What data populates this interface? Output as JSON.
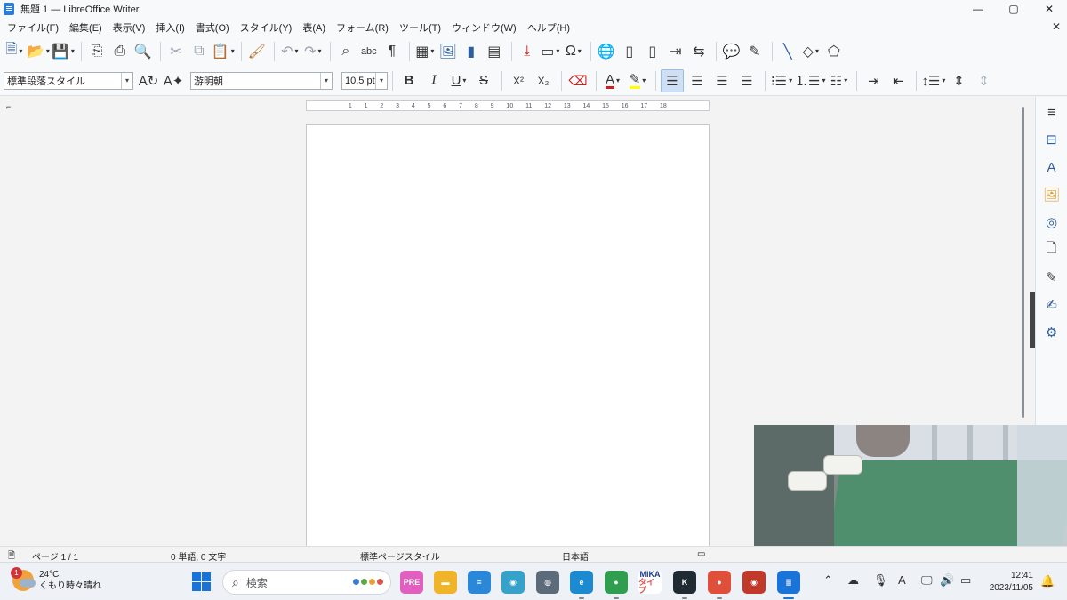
{
  "window": {
    "title": "無題 1 — LibreOffice Writer",
    "controls": {
      "minimize": "—",
      "maximize": "▢",
      "close": "✕"
    }
  },
  "menubar": {
    "items": [
      "ファイル(F)",
      "編集(E)",
      "表示(V)",
      "挿入(I)",
      "書式(O)",
      "スタイル(Y)",
      "表(A)",
      "フォーム(R)",
      "ツール(T)",
      "ウィンドウ(W)",
      "ヘルプ(H)"
    ],
    "close_doc": "✕"
  },
  "formatting": {
    "paragraph_style": "標準段落スタイル",
    "font_name": "游明朝",
    "font_size": "10.5 pt",
    "bold": "B",
    "italic": "I",
    "underline": "U",
    "strike": "S",
    "superscript": "X²",
    "subscript": "X₂",
    "font_color_letter": "A"
  },
  "ruler": {
    "ticks": [
      "1",
      "1",
      "2",
      "3",
      "4",
      "5",
      "6",
      "7",
      "8",
      "9",
      "10",
      "11",
      "12",
      "13",
      "14",
      "15",
      "16",
      "17",
      "18"
    ]
  },
  "statusbar": {
    "page": "ページ 1 / 1",
    "words": "0 単語, 0 文字",
    "page_style": "標準ページスタイル",
    "language": "日本語"
  },
  "taskbar": {
    "weather_temp": "24°C",
    "weather_desc": "くもり時々晴れ",
    "weather_badge": "1",
    "search_placeholder": "検索",
    "clock_time": "12:41",
    "clock_date": "2023/11/05",
    "mika_label": "MIKA",
    "mika_sub": "タイプ",
    "ime_label": "A"
  },
  "colors": {
    "accent": "#1a73d9",
    "font_color": "#c9211e",
    "highlight": "#ffff00"
  }
}
